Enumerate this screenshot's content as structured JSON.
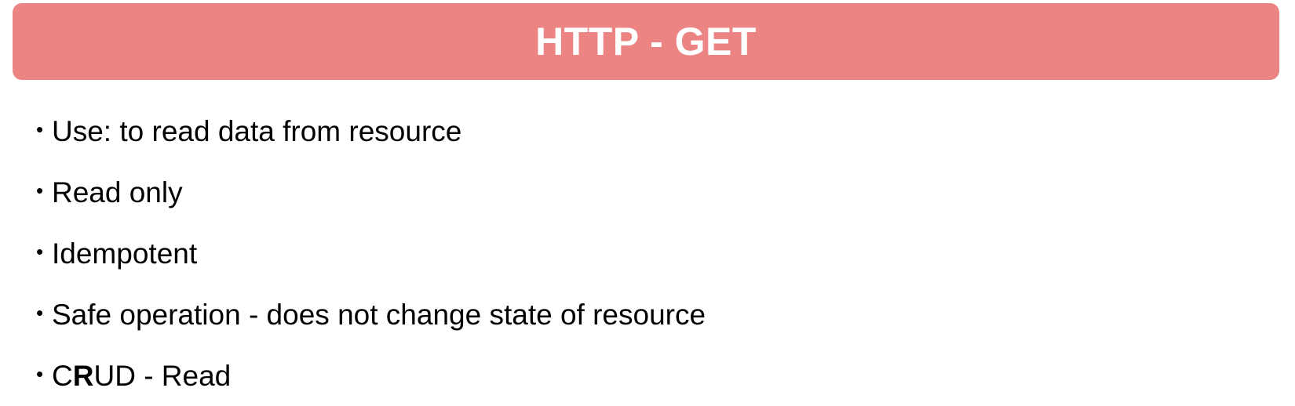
{
  "slide": {
    "title": "HTTP - GET",
    "title_bar_color": "#eb8482",
    "bullet_symbol": "•",
    "bullets": [
      {
        "text": "Use: to read data from resource"
      },
      {
        "text": "Read only"
      },
      {
        "text": "Idempotent"
      },
      {
        "text": "Safe operation - does not change state of resource"
      },
      {
        "pre": "C",
        "bold": "R",
        "post": "UD - Read"
      }
    ]
  }
}
